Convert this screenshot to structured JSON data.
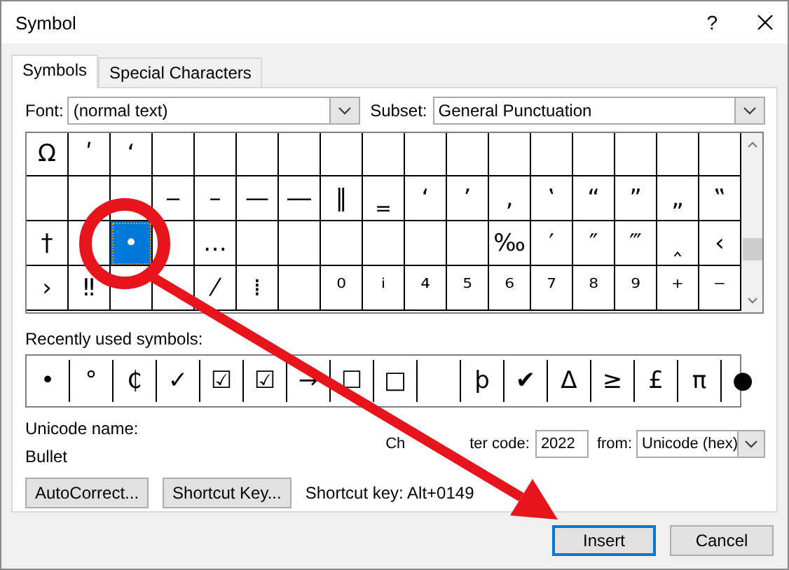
{
  "window": {
    "title": "Symbol",
    "help": "?"
  },
  "tabs": [
    {
      "label": "Symbols",
      "selected": true
    },
    {
      "label": "Special Characters",
      "selected": false
    }
  ],
  "font": {
    "label": "Font:",
    "value": "(normal text)"
  },
  "subset": {
    "label": "Subset:",
    "value": "General Punctuation"
  },
  "grid": [
    [
      {
        "char": "Ω",
        "selected": false
      },
      {
        "char": "ʹ",
        "selected": false
      },
      {
        "char": "ʻ",
        "selected": false
      },
      {
        "selected": false
      },
      {
        "selected": false
      },
      {
        "selected": false
      },
      {
        "selected": false
      },
      {
        "selected": false
      },
      {
        "selected": false
      },
      {
        "selected": false
      },
      {
        "selected": false
      },
      {
        "selected": false
      },
      {
        "selected": false
      },
      {
        "selected": false
      },
      {
        "selected": false
      },
      {
        "selected": false
      },
      {
        "selected": false
      }
    ],
    [
      {
        "selected": false
      },
      {
        "selected": false
      },
      {
        "selected": false
      },
      {
        "char": "‒",
        "selected": false
      },
      {
        "char": "–",
        "selected": false
      },
      {
        "char": "—",
        "selected": false
      },
      {
        "char": "―",
        "selected": false
      },
      {
        "char": "‖",
        "selected": false
      },
      {
        "char": "‗",
        "selected": false
      },
      {
        "char": "‘",
        "selected": false
      },
      {
        "char": "’",
        "selected": false
      },
      {
        "char": "‚",
        "selected": false
      },
      {
        "char": "‛",
        "selected": false
      },
      {
        "char": "“",
        "selected": false
      },
      {
        "char": "”",
        "selected": false
      },
      {
        "char": "„",
        "selected": false
      },
      {
        "char": "‟",
        "selected": false
      }
    ],
    [
      {
        "char": "†",
        "selected": false
      },
      {
        "selected": false
      },
      {
        "char": "•",
        "selected": true
      },
      {
        "selected": false
      },
      {
        "char": "…",
        "selected": false
      },
      {
        "selected": false
      },
      {
        "selected": false
      },
      {
        "selected": false
      },
      {
        "selected": false
      },
      {
        "selected": false
      },
      {
        "selected": false
      },
      {
        "char": "‰",
        "selected": false
      },
      {
        "char": "′",
        "selected": false
      },
      {
        "char": "″",
        "selected": false
      },
      {
        "char": "‴",
        "selected": false
      },
      {
        "char": "‸",
        "selected": false
      },
      {
        "char": "‹",
        "selected": false
      }
    ],
    [
      {
        "char": "›",
        "selected": false
      },
      {
        "char": "‼",
        "selected": false
      },
      {
        "selected": false
      },
      {
        "selected": false
      },
      {
        "char": "⁄",
        "selected": false
      },
      {
        "char": "⁞",
        "selected": false
      },
      {
        "selected": false
      },
      {
        "char": "⁰",
        "selected": false
      },
      {
        "char": "ⁱ",
        "selected": false
      },
      {
        "char": "⁴",
        "selected": false
      },
      {
        "char": "⁵",
        "selected": false
      },
      {
        "char": "⁶",
        "selected": false
      },
      {
        "char": "⁷",
        "selected": false
      },
      {
        "char": "⁸",
        "selected": false
      },
      {
        "char": "⁹",
        "selected": false
      },
      {
        "char": "⁺",
        "selected": false
      },
      {
        "char": "⁻",
        "selected": false
      }
    ]
  ],
  "recent": {
    "label": "Recently used symbols:",
    "items": [
      {
        "kind": "symbol",
        "char": "•"
      },
      {
        "kind": "symbol",
        "char": "°"
      },
      {
        "kind": "symbol",
        "char": "₵"
      },
      {
        "kind": "symbol",
        "char": "✓"
      },
      {
        "kind": "symbol",
        "char": "☑"
      },
      {
        "kind": "symbol",
        "char": "☑"
      },
      {
        "kind": "symbol",
        "char": "→"
      },
      {
        "kind": "symbol",
        "char": "☐"
      },
      {
        "kind": "symbol",
        "char": "□"
      },
      {
        "kind": "blank"
      },
      {
        "kind": "symbol",
        "char": "þ"
      },
      {
        "kind": "symbol",
        "char": "✔"
      },
      {
        "kind": "symbol",
        "char": "Δ"
      },
      {
        "kind": "symbol",
        "char": "≥"
      },
      {
        "kind": "symbol",
        "char": "£"
      },
      {
        "kind": "symbol",
        "char": "π"
      },
      {
        "kind": "symbol",
        "char": "●"
      }
    ]
  },
  "unicode_name": {
    "label": "Unicode name:",
    "value": "Bullet"
  },
  "character_code": {
    "label_parts": [
      "Ch",
      "ter code:"
    ],
    "value": "2022"
  },
  "from": {
    "label": "from:",
    "value": "Unicode (hex)"
  },
  "buttons": [
    "AutoCorrect...",
    "Shortcut Key..."
  ],
  "shortcut": "Shortcut key: Alt+0149",
  "dialog_buttons": [
    {
      "label": "Insert",
      "selected": true
    },
    {
      "label": "Cancel",
      "selected": false
    }
  ]
}
